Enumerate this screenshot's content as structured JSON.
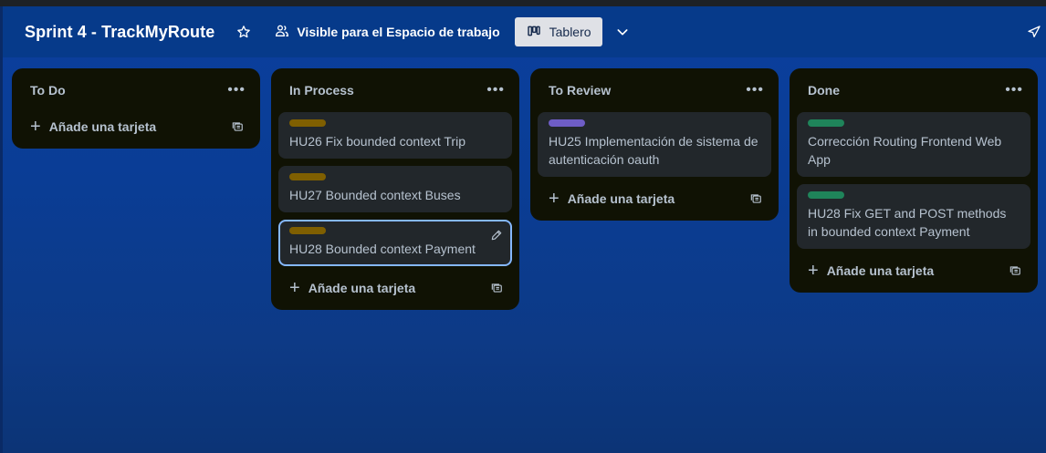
{
  "header": {
    "title": "Sprint 4 - TrackMyRoute",
    "visibility_label": "Visible para el Espacio de trabajo",
    "view_label": "Tablero"
  },
  "colors": {
    "yellow_label": "#7f5f01",
    "purple_label": "#6e5dc6",
    "green_label": "#1f845a"
  },
  "lists": [
    {
      "title": "To Do",
      "add_label": "Añade una tarjeta",
      "cards": []
    },
    {
      "title": "In Process",
      "add_label": "Añade una tarjeta",
      "cards": [
        {
          "label_color": "yellow",
          "text": "HU26 Fix bounded context Trip"
        },
        {
          "label_color": "yellow",
          "text": "HU27 Bounded context Buses"
        },
        {
          "label_color": "yellow",
          "text": "HU28 Bounded context Payment"
        }
      ]
    },
    {
      "title": "To Review",
      "add_label": "Añade una tarjeta",
      "cards": [
        {
          "label_color": "purple",
          "text": "HU25 Implementación de sistema de autenticación oauth"
        }
      ]
    },
    {
      "title": "Done",
      "add_label": "Añade una tarjeta",
      "cards": [
        {
          "label_color": "green",
          "text": "Corrección Routing Frontend Web App"
        },
        {
          "label_color": "green",
          "text": "HU28 Fix GET and POST methods in bounded context Payment"
        }
      ]
    }
  ]
}
